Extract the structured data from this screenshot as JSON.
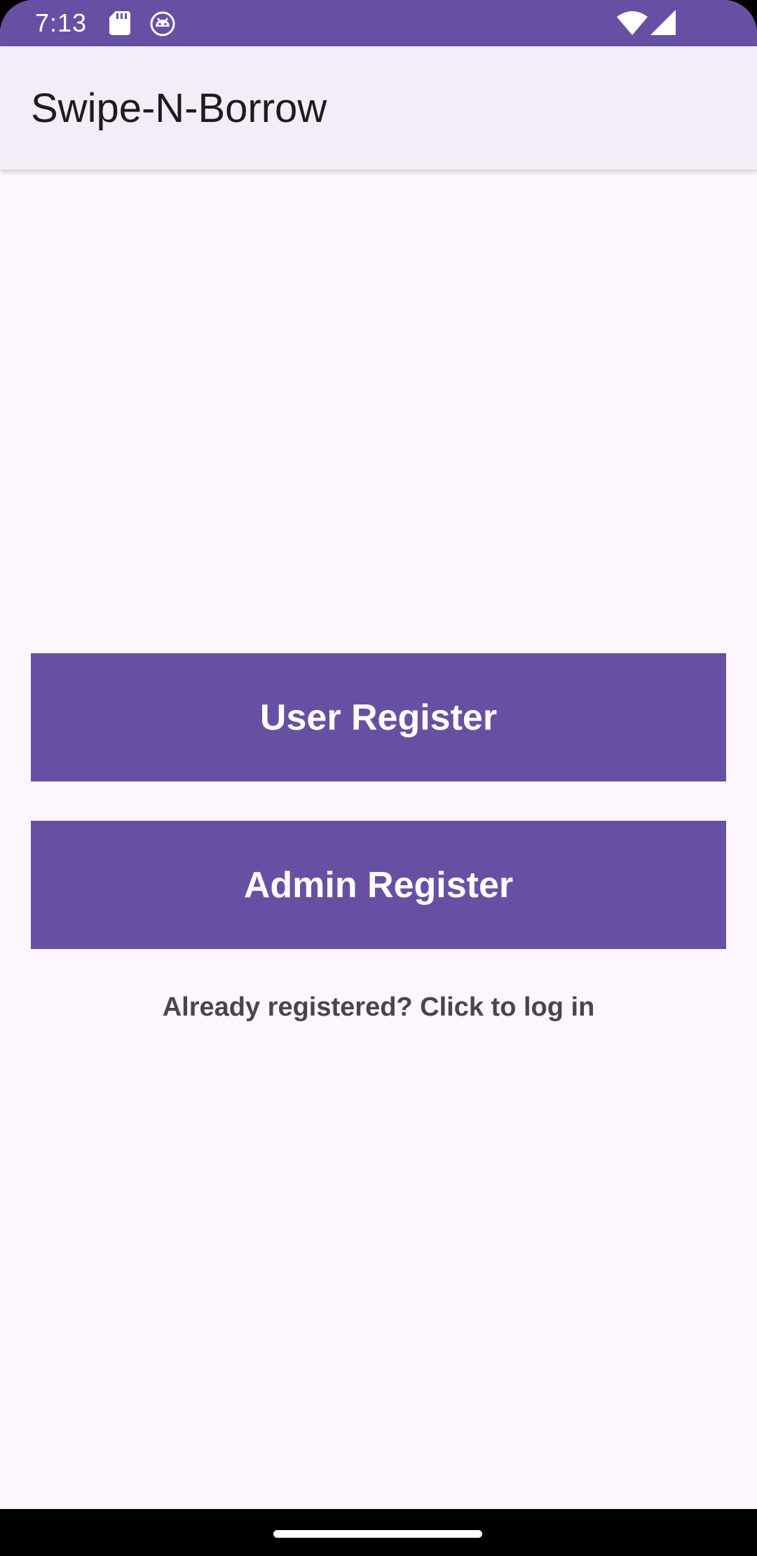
{
  "status_bar": {
    "time": "7:13",
    "icons": [
      "sd-card-icon",
      "android-icon",
      "wifi-icon",
      "cell-signal-icon"
    ],
    "color": "#6750A4"
  },
  "app_bar": {
    "title": "Swipe-N-Borrow",
    "background": "#F2EDF7"
  },
  "main": {
    "user_register_label": "User Register",
    "admin_register_label": "Admin Register",
    "login_link_text": "Already registered? Click to log in",
    "button_color": "#6750A4",
    "background": "#FDF7FD"
  }
}
